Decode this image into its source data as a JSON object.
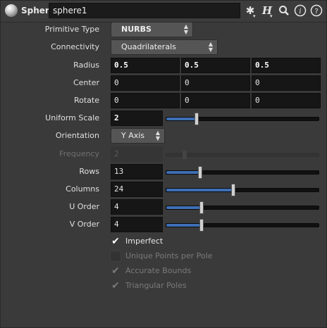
{
  "header": {
    "node_type": "Sphere",
    "node_name": "sphere1",
    "icons": [
      "gear-icon",
      "help-h-icon",
      "search-icon",
      "info-icon",
      "help-icon"
    ]
  },
  "params": {
    "primitive_type": {
      "label": "Primitive Type",
      "value": "NURBS"
    },
    "connectivity": {
      "label": "Connectivity",
      "value": "Quadrilaterals"
    },
    "radius": {
      "label": "Radius",
      "values": [
        "0.5",
        "0.5",
        "0.5"
      ]
    },
    "center": {
      "label": "Center",
      "values": [
        "0",
        "0",
        "0"
      ]
    },
    "rotate": {
      "label": "Rotate",
      "values": [
        "0",
        "0",
        "0"
      ]
    },
    "uniform_scale": {
      "label": "Uniform Scale",
      "value": "2",
      "slider_fraction": 0.2
    },
    "orientation": {
      "label": "Orientation",
      "value": "Y Axis"
    },
    "frequency": {
      "label": "Frequency",
      "value": "2",
      "disabled": true,
      "slider_fraction": 0.12
    },
    "rows": {
      "label": "Rows",
      "value": "13",
      "slider_fraction": 0.22
    },
    "columns": {
      "label": "Columns",
      "value": "24",
      "slider_fraction": 0.44
    },
    "u_order": {
      "label": "U Order",
      "value": "4",
      "slider_fraction": 0.23
    },
    "v_order": {
      "label": "V Order",
      "value": "4",
      "slider_fraction": 0.23
    }
  },
  "toggles": [
    {
      "label": "Imperfect",
      "checked": true,
      "disabled": false
    },
    {
      "label": "Unique Points per Pole",
      "checked": false,
      "disabled": true
    },
    {
      "label": "Accurate Bounds",
      "checked": true,
      "disabled": true
    },
    {
      "label": "Triangular Poles",
      "checked": true,
      "disabled": true
    }
  ],
  "colors": {
    "accent": "#3e6fb5",
    "background": "#3a3a3a",
    "field": "#161616"
  }
}
